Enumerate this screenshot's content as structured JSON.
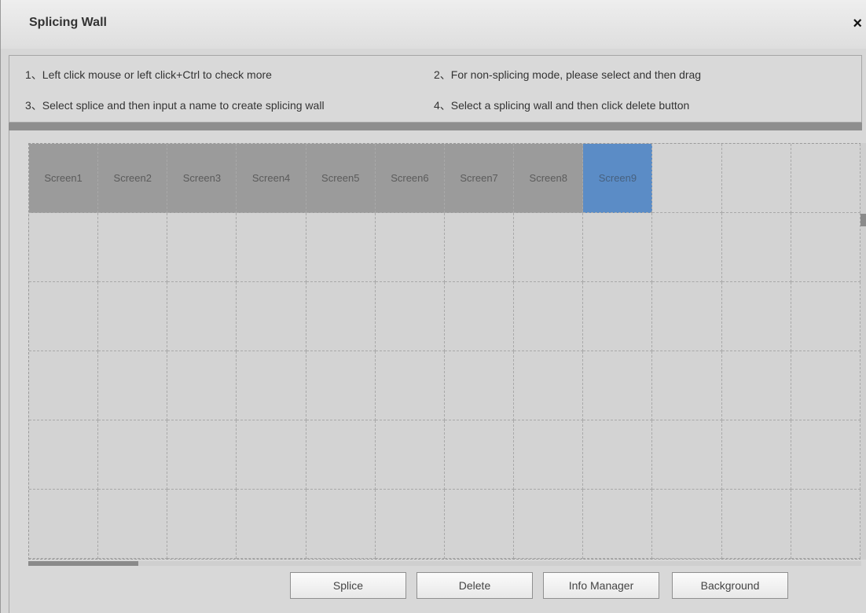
{
  "dialog": {
    "title": "Splicing Wall",
    "close_label": "×"
  },
  "instructions": [
    "1、Left click mouse or left click+Ctrl to check more",
    "2、For non-splicing mode, please select and then drag",
    "3、Select splice and then input a name to create splicing wall",
    "4、Select a splicing wall and then click delete button"
  ],
  "grid": {
    "columns": 12,
    "rows": 6,
    "screens": [
      "Screen1",
      "Screen2",
      "Screen3",
      "Screen4",
      "Screen5",
      "Screen6",
      "Screen7",
      "Screen8",
      "Screen9"
    ],
    "selected_screen": "Screen9",
    "colors": {
      "screen": "#9b9b9b",
      "selected": "#5b8cc6",
      "empty": "#d3d3d3"
    }
  },
  "buttons": {
    "splice": "Splice",
    "delete": "Delete",
    "info_manager": "Info Manager",
    "background": "Background"
  }
}
